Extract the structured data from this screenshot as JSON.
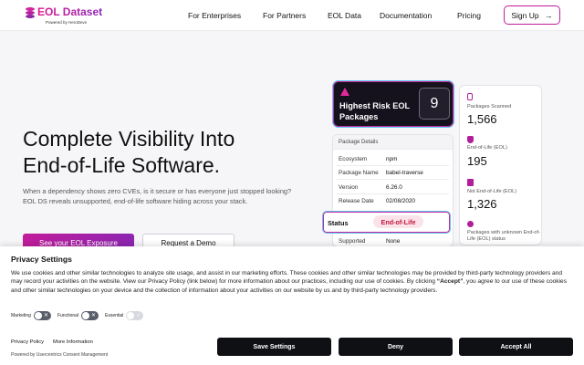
{
  "brand": {
    "name": "EOL Dataset",
    "powered_by": "Powered by HeroDevs",
    "colors": {
      "accent": "#c21c9b",
      "accent2": "#8d26b1",
      "highlight": "#5ec8f0"
    }
  },
  "nav": {
    "items": [
      "For Enterprises",
      "For Partners",
      "EOL Data",
      "Documentation",
      "Pricing"
    ],
    "signup": "Sign Up",
    "signup_icon": "arrow-right-icon"
  },
  "hero": {
    "title_line1": "Complete Visibility Into",
    "title_line2": "End-of-Life Software.",
    "description": "When a dependency shows zero CVEs, is it secure or has everyone just stopped looking? EOL DS reveals unsupported, end-of-life software hiding across your stack.",
    "cta_primary": "See your EOL Exposure",
    "cta_secondary": "Request a Demo"
  },
  "risk_card": {
    "title": "Highest Risk EOL Packages",
    "count": "9",
    "icon": "warning-icon"
  },
  "package_details": {
    "header": "Package Details",
    "rows": [
      {
        "label": "Ecosystem",
        "value": "npm"
      },
      {
        "label": "Package Name",
        "value": "babel-traverse"
      },
      {
        "label": "Version",
        "value": "6.26.0"
      },
      {
        "label": "Release Date",
        "value": "02/08/2020"
      },
      {
        "label": "Supported",
        "value": "None"
      }
    ],
    "status_label": "Status",
    "status_value": "End-of-Life",
    "status_color": "#c8153d"
  },
  "stats": [
    {
      "label": "Packages Scanned",
      "value": "1,566",
      "icon": "brackets-icon"
    },
    {
      "label": "End-of-Life (EOL)",
      "value": "195",
      "icon": "shield-icon"
    },
    {
      "label": "Not End-of-Life (EOL)",
      "value": "1,326",
      "icon": "check-icon"
    },
    {
      "label": "Packages with unknown End-of-Life (EOL) status",
      "value": "",
      "icon": "question-icon"
    }
  ],
  "privacy": {
    "title": "Privacy Settings",
    "body_part1": "We use cookies and other similar technologies to analyze site usage, and assist in our marketing efforts. These cookies and other similar technologies may be provided by third-party technology providers and may record your activities on the website. View our Privacy Policy (link below) for more information about our practices, including our use of cookies. By clicking ",
    "body_bold": "“Accept”",
    "body_part2": ", you agree to our use of these cookies and other similar technologies on your device and the collection of information about your activities on our website by us and by third-party technology providers.",
    "toggles": [
      {
        "label": "Marketing",
        "disabled": false
      },
      {
        "label": "Functional",
        "disabled": false
      },
      {
        "label": "Essential",
        "disabled": true
      }
    ],
    "links": [
      "Privacy Policy",
      "More Information"
    ],
    "powered_by": "Powered by Usercentrics Consent Management",
    "buttons": {
      "save": "Save Settings",
      "deny": "Deny",
      "accept": "Accept All"
    }
  }
}
